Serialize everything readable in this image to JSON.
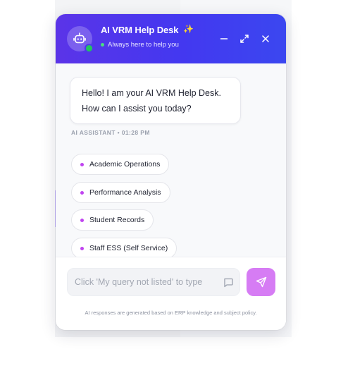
{
  "header": {
    "title": "AI VRM Help Desk",
    "sparkle_icon": "sparkle-icon",
    "status": "Always here to help you",
    "status_color": "#22c55e",
    "minimize_icon": "minimize-icon",
    "expand_icon": "expand-icon",
    "close_icon": "close-icon",
    "avatar_icon": "robot-icon",
    "gradient": [
      "#5b34e8",
      "#3b47f0"
    ]
  },
  "conversation": {
    "bot_message_line1": "Hello! I am your AI VRM Help Desk.",
    "bot_message_line2": "How can I assist you today?",
    "meta": "AI ASSISTANT • 01:28 PM"
  },
  "quick_replies": [
    {
      "label": "Academic Operations"
    },
    {
      "label": "Performance Analysis"
    },
    {
      "label": "Student Records"
    },
    {
      "label": "Staff ESS (Self Service)"
    }
  ],
  "composer": {
    "placeholder": "Click 'My query not listed' to type",
    "value": "",
    "message_icon": "message-square-icon",
    "send_icon": "send-icon",
    "send_color": "#d67cf4"
  },
  "disclaimer": "AI responses are generated based on ERP knowledge and subject policy."
}
